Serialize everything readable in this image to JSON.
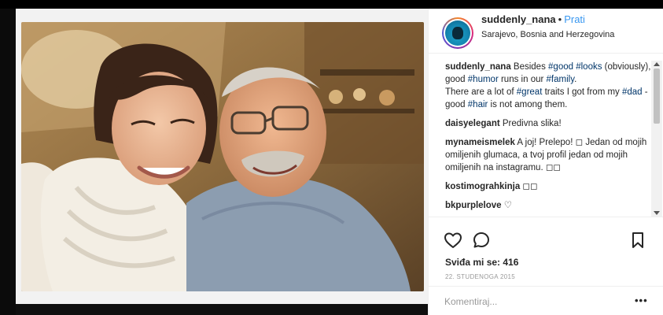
{
  "post": {
    "username": "suddenly_nana",
    "separator": "•",
    "follow_label": "Prati",
    "location": "Sarajevo, Bosnia and Herzegovina",
    "likes_text": "Sviđa mi se: 416",
    "date": "22. STUDENOGA 2015",
    "comment_placeholder": "Komentiraj...",
    "more_label": "•••"
  },
  "caption": {
    "user": "suddenly_nana",
    "parts": [
      " Besides ",
      "#good",
      " ",
      "#looks",
      " (obviously), good ",
      "#humor",
      " runs in our ",
      "#family",
      ".",
      " There are a lot of ",
      "#great",
      " traits I got from my ",
      "#dad",
      " - good ",
      "#hair",
      " is not among them."
    ]
  },
  "comments": [
    {
      "user": "daisyelegant",
      "text": " Predivna slika!"
    },
    {
      "user": "mynameismelek",
      "text": " A joj! Prelepo! ◻ Jedan od mojih omiljenih glumaca, a tvoj profil jedan od mojih omiljenih na instagramu. ◻◻"
    },
    {
      "user": "kostimograhkinja",
      "text": " ◻◻"
    },
    {
      "user": "bkpurplelove",
      "text": " ♡"
    }
  ],
  "icons": {
    "like": "heart-outline-icon",
    "comment": "speech-bubble-icon",
    "save": "bookmark-icon",
    "more": "more-options-icon"
  },
  "colors": {
    "link": "#3897f0",
    "hashtag": "#003569",
    "date": "#999999"
  }
}
